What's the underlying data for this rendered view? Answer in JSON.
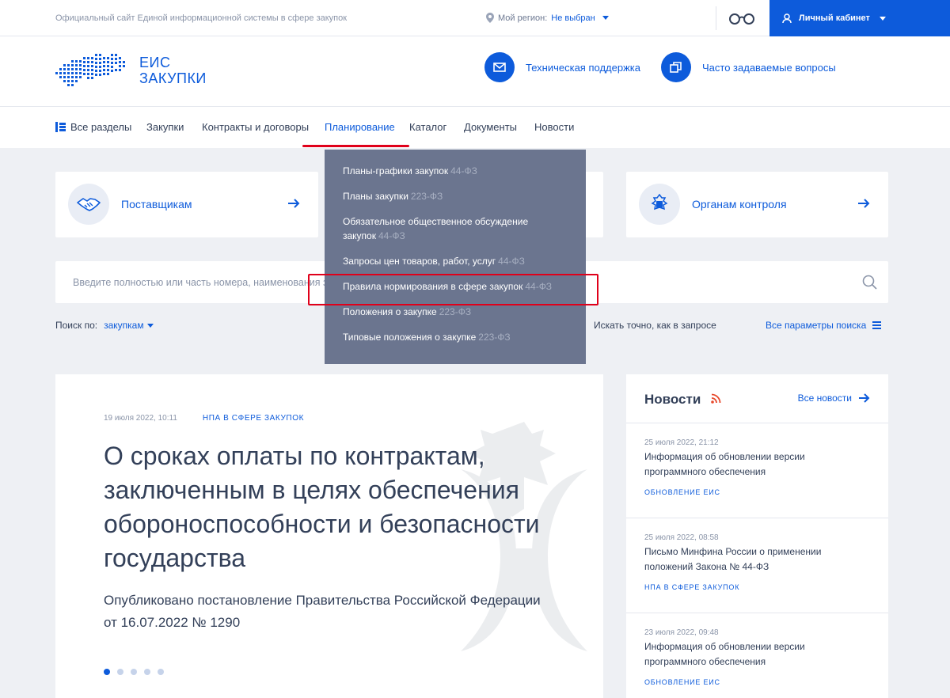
{
  "topbar": {
    "site_title": "Официальный сайт Единой информационной системы в сфере закупок",
    "region_label": "Мой регион:",
    "region_value": "Не выбран",
    "cabinet_label": "Личный кабинет"
  },
  "header": {
    "logo_line1": "ЕИС",
    "logo_line2": "ЗАКУПКИ",
    "support_label": "Техническая поддержка",
    "faq_label": "Часто задаваемые вопросы"
  },
  "nav": {
    "items": [
      {
        "label": "Все разделы"
      },
      {
        "label": "Закупки"
      },
      {
        "label": "Контракты и договоры"
      },
      {
        "label": "Планирование"
      },
      {
        "label": "Каталог"
      },
      {
        "label": "Документы"
      },
      {
        "label": "Новости"
      }
    ]
  },
  "dropdown": {
    "items": [
      {
        "label": "Планы-графики закупок",
        "law": "44-ФЗ"
      },
      {
        "label": "Планы закупки",
        "law": "223-ФЗ"
      },
      {
        "label": "Обязательное общественное обсуждение закупок",
        "law": "44-ФЗ"
      },
      {
        "label": "Запросы цен товаров, работ, услуг",
        "law": "44-ФЗ"
      },
      {
        "label": "Правила нормирования в сфере закупок",
        "law": "44-ФЗ"
      },
      {
        "label": "Положения о закупке",
        "law": "223-ФЗ"
      },
      {
        "label": "Типовые положения о закупке",
        "law": "223-ФЗ"
      }
    ]
  },
  "cards": {
    "suppliers": "Поставщикам",
    "control": "Органам контроля"
  },
  "search": {
    "placeholder": "Введите полностью или часть номера, наименования закупки, наименования или ИНН Заказчика",
    "by_label": "Поиск по:",
    "by_value": "закупкам",
    "exact_label": "Искать точно, как в запросе",
    "all_params_label": "Все параметры поиска"
  },
  "slide": {
    "date": "19 июля 2022, 10:11",
    "tag": "НПА в сфере закупок",
    "headline": "О сроках оплаты по контрактам, заключенным в целях обеспечения обороноспособности и безопасности государства",
    "lead": "Опубликовано постановление Правительства Российской Федерации от 16.07.2022 № 1290"
  },
  "news": {
    "title": "Новости",
    "all_label": "Все новости",
    "items": [
      {
        "date": "25 июля 2022, 21:12",
        "text": "Информация об обновлении версии программного обеспечения",
        "tag": "Обновление ЕИС"
      },
      {
        "date": "25 июля 2022, 08:58",
        "text": "Письмо Минфина России о применении положений Закона № 44-ФЗ",
        "tag": "НПА в сфере закупок"
      },
      {
        "date": "23 июля 2022, 09:48",
        "text": "Информация об обновлении версии программного обеспечения",
        "tag": "Обновление ЕИС"
      }
    ]
  },
  "colors": {
    "accent": "#0d5bdb",
    "highlight": "#e0001a",
    "dropdown_bg": "#6b758f"
  }
}
